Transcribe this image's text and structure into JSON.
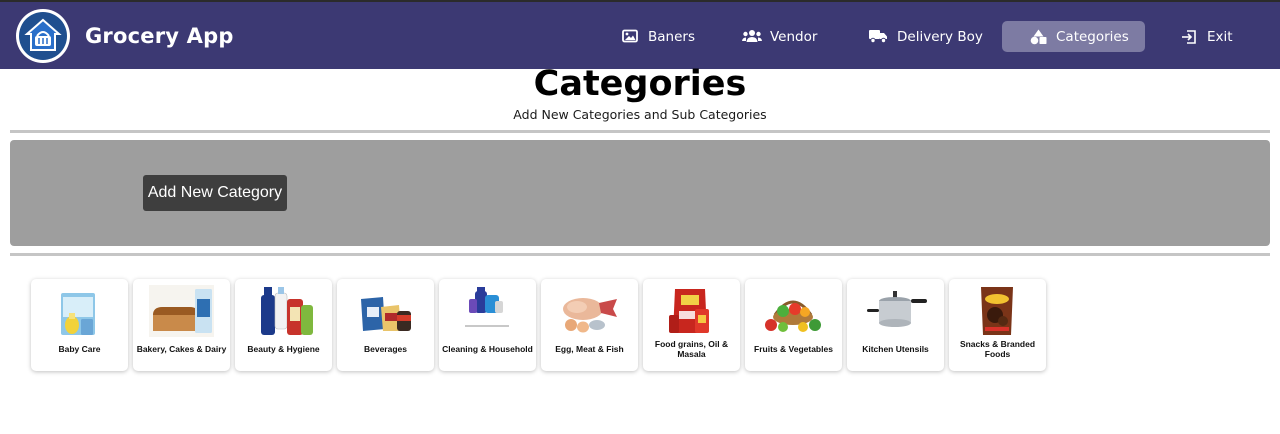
{
  "header": {
    "brand": "Grocery App",
    "nav": [
      {
        "label": "Baners",
        "icon": "image-icon",
        "active": false
      },
      {
        "label": "Vendor",
        "icon": "users-icon",
        "active": false
      },
      {
        "label": "Delivery Boy",
        "icon": "truck-icon",
        "active": false
      },
      {
        "label": "Categories",
        "icon": "shapes-icon",
        "active": true
      },
      {
        "label": "Exit",
        "icon": "exit-icon",
        "active": false
      }
    ]
  },
  "page": {
    "title": "Categories",
    "subtitle": "Add New Categories and Sub Categories"
  },
  "actions": {
    "add_category": "Add New Category"
  },
  "categories": [
    {
      "label": "Baby Care"
    },
    {
      "label": "Bakery, Cakes & Dairy"
    },
    {
      "label": "Beauty & Hygiene"
    },
    {
      "label": "Beverages"
    },
    {
      "label": "Cleaning & Household"
    },
    {
      "label": "Egg, Meat & Fish"
    },
    {
      "label": "Food grains, Oil & Masala"
    },
    {
      "label": "Fruits & Vegetables"
    },
    {
      "label": "Kitchen Utensils"
    },
    {
      "label": "Snacks & Branded Foods"
    }
  ],
  "colors": {
    "topbar": "#3c3973",
    "active_nav": "#7d7ba3",
    "panel": "#9e9e9e",
    "button": "#3e3e3e"
  }
}
